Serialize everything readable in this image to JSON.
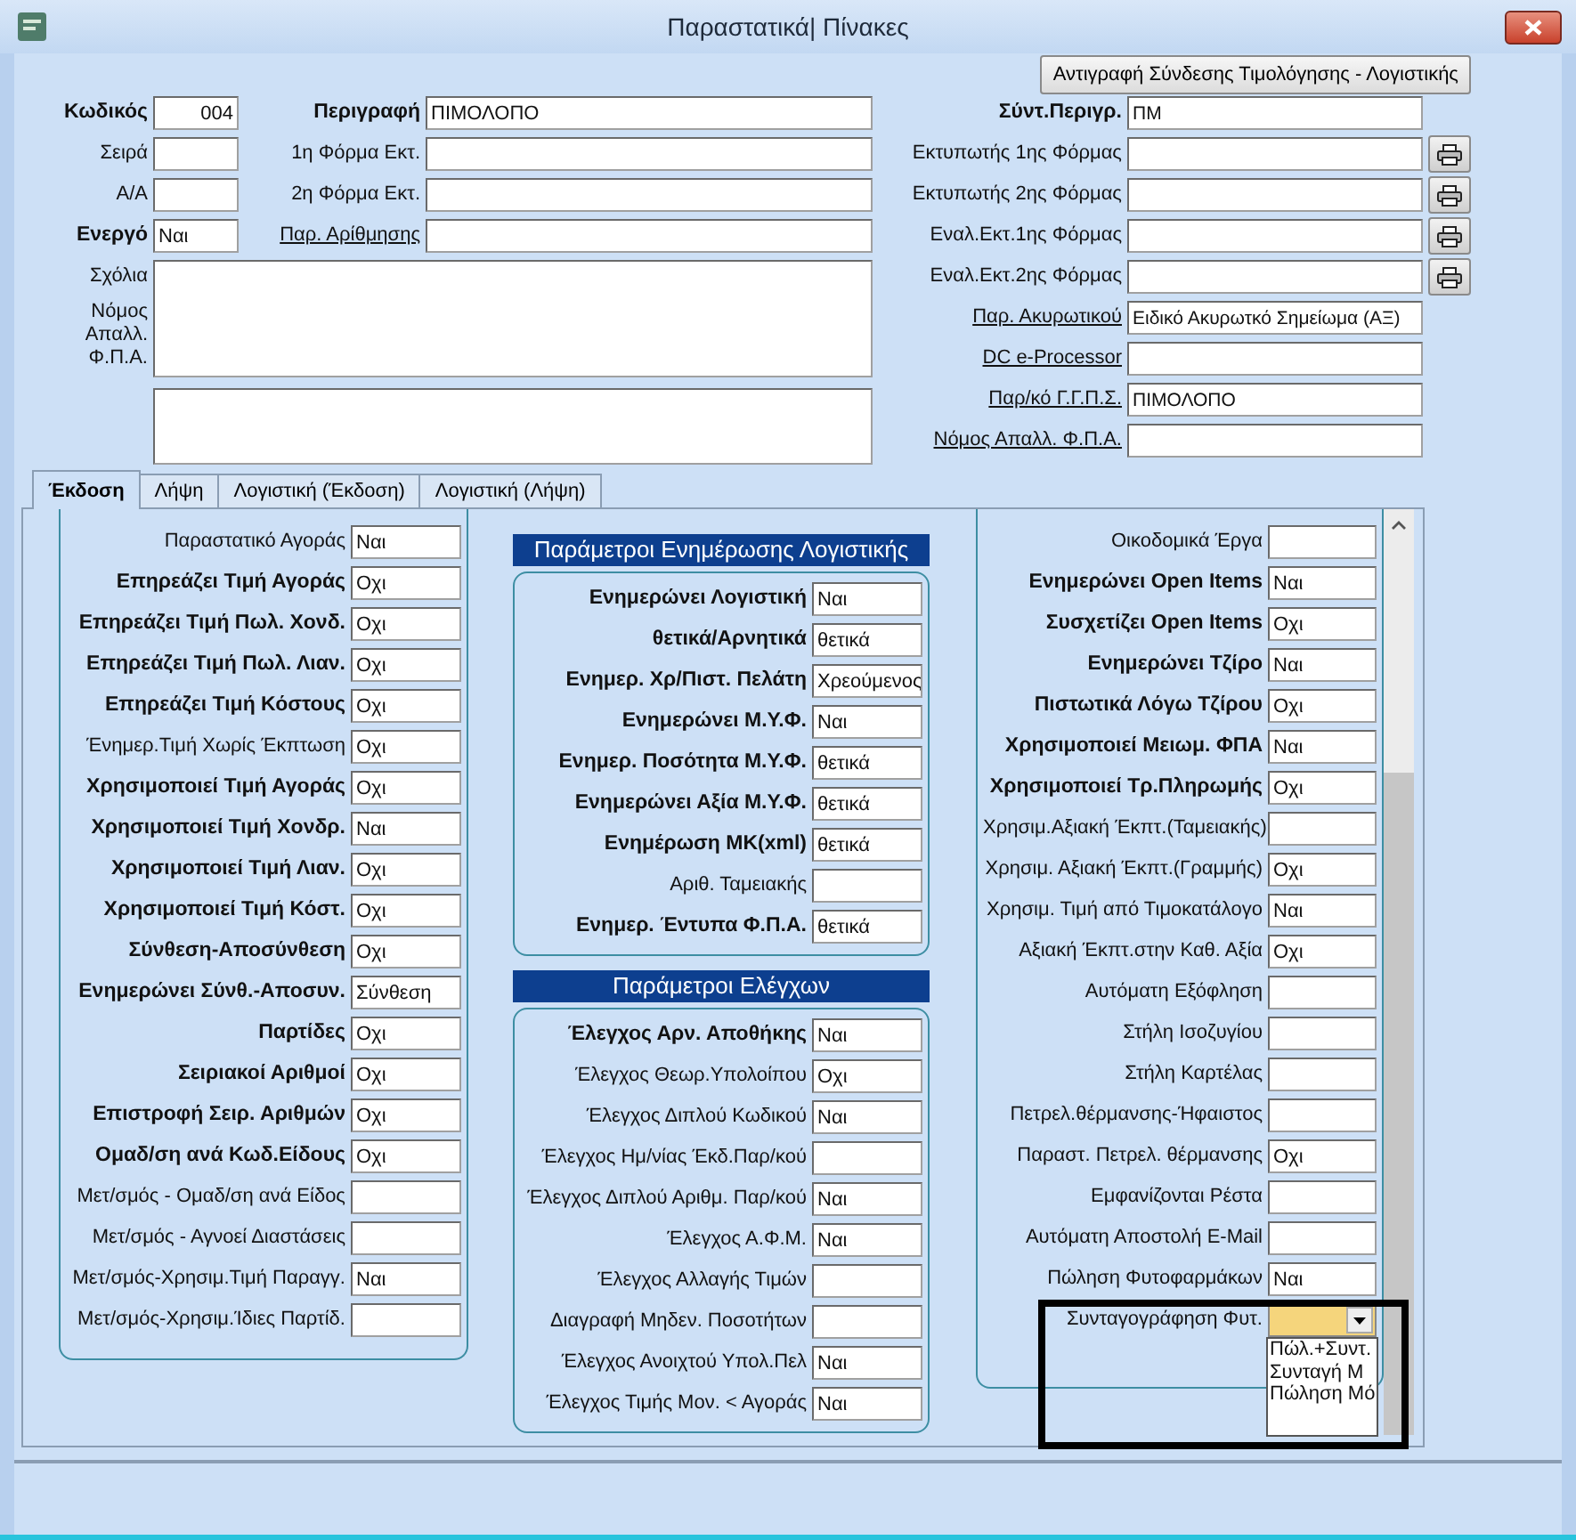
{
  "window": {
    "title": "Παραστατικά| Πίνακες"
  },
  "copy_button": "Αντιγραφή Σύνδεσης Τιμολόγησης - Λογιστικής",
  "header_rows": [
    {
      "left": {
        "label": "Κωδικός",
        "kind": "bold",
        "value": "004"
      },
      "right": {
        "label": "Περιγραφή",
        "kind": "bold",
        "value": "ΠΙΜΟΛΟΠΟ"
      }
    },
    {
      "left": {
        "label": "Σειρά",
        "kind": "normal"
      },
      "right": {
        "label": "1η Φόρμα Εκτ.",
        "kind": "normal"
      }
    },
    {
      "left": {
        "label": "Α/Α",
        "kind": "normal"
      },
      "right": {
        "label": "2η Φόρμα Εκτ.",
        "kind": "normal"
      }
    },
    {
      "left": {
        "label": "Ενεργό",
        "kind": "bold",
        "value": "Ναι"
      },
      "right": {
        "label": "Παρ. Αρίθμησης",
        "kind": "link"
      }
    }
  ],
  "notes": {
    "label": "Σχόλια"
  },
  "vat_exemption": {
    "label": "Νόμος Απαλλ. Φ.Π.Α."
  },
  "right_fields": [
    {
      "label": "Σύντ.Περιγρ.",
      "kind": "bold",
      "value": "ΠΜ",
      "print_button": false
    },
    {
      "label": "Εκτυπωτής 1ης Φόρμας",
      "kind": "normal",
      "print_button": true
    },
    {
      "label": "Εκτυπωτής 2ης Φόρμας",
      "kind": "normal",
      "print_button": true
    },
    {
      "label": "Εναλ.Εκτ.1ης Φόρμας",
      "kind": "normal",
      "print_button": true
    },
    {
      "label": "Εναλ.Εκτ.2ης Φόρμας",
      "kind": "normal",
      "print_button": true
    },
    {
      "label": "Παρ. Ακυρωτικού",
      "kind": "link",
      "value": "Ειδικό Ακυρωτκό Σημείωμα (ΑΞ)",
      "print_button": false
    },
    {
      "label": "DC e-Processor",
      "kind": "link",
      "print_button": false
    },
    {
      "label": "Παρ/κό Γ.Γ.Π.Σ.",
      "kind": "link",
      "value": "ΠΙΜΟΛΟΠΟ",
      "print_button": false
    },
    {
      "label": "Νόμος Απαλλ. Φ.Π.Α.",
      "kind": "link",
      "print_button": false
    }
  ],
  "tabs": [
    {
      "label": "Έκδοση",
      "selected": true
    },
    {
      "label": "Λήψη",
      "selected": false
    },
    {
      "label": "Λογιστική (Έκδοση)",
      "selected": false
    },
    {
      "label": "Λογιστική (Λήψη)",
      "selected": false
    }
  ],
  "left_group": {
    "fields": [
      {
        "label": "Παραστατικό Αγοράς",
        "kind": "normal",
        "value": "Ναι"
      },
      {
        "label": "Επηρεάζει Τιμή Αγοράς",
        "kind": "bold",
        "value": "Οχι"
      },
      {
        "label": "Επηρεάζει Τιμή Πωλ. Χονδ.",
        "kind": "bold",
        "value": "Οχι"
      },
      {
        "label": "Επηρεάζει Τιμή Πωλ. Λιαν.",
        "kind": "bold",
        "value": "Οχι"
      },
      {
        "label": "Επηρεάζει Τιμή Κόστους",
        "kind": "bold",
        "value": "Οχι"
      },
      {
        "label": "Ένημερ.Τιμή Χωρίς Έκπτωση",
        "kind": "normal",
        "value": "Οχι"
      },
      {
        "label": "Χρησιμοποιεί Τιμή Αγοράς",
        "kind": "bold",
        "value": "Οχι"
      },
      {
        "label": "Χρησιμοποιεί Τιμή Χονδρ.",
        "kind": "bold",
        "value": "Ναι"
      },
      {
        "label": "Χρησιμοποιεί Τιμή Λιαν.",
        "kind": "bold",
        "value": "Οχι"
      },
      {
        "label": "Χρησιμοποιεί Τιμή Κόστ.",
        "kind": "bold",
        "value": "Οχι"
      },
      {
        "label": "Σύνθεση-Αποσύνθεση",
        "kind": "bold",
        "value": "Οχι"
      },
      {
        "label": "Ενημερώνει Σύνθ.-Αποσυν.",
        "kind": "bold",
        "value": "Σύνθεση"
      },
      {
        "label": "Παρτίδες",
        "kind": "bold",
        "value": "Οχι"
      },
      {
        "label": "Σειριακοί Αριθμοί",
        "kind": "bold",
        "value": "Οχι"
      },
      {
        "label": "Επιστροφή Σειρ. Αριθμών",
        "kind": "bold",
        "value": "Οχι"
      },
      {
        "label": "Ομαδ/ση ανά Κωδ.Είδους",
        "kind": "bold",
        "value": "Οχι"
      },
      {
        "label": "Μετ/σμός - Ομαδ/ση ανά Είδος",
        "kind": "normal"
      },
      {
        "label": "Μετ/σμός - Αγνοεί Διαστάσεις",
        "kind": "normal"
      },
      {
        "label": "Μετ/σμός-Χρησιμ.Τιμή Παραγγ.",
        "kind": "normal",
        "value": "Ναι"
      },
      {
        "label": "Μετ/σμός-Χρησιμ.Ίδιες Παρτίδ.",
        "kind": "normal"
      }
    ]
  },
  "middle_groups": [
    {
      "title": "Παράμετροι Ενημέρωσης Λογιστικής",
      "fields": [
        {
          "label": "Ενημερώνει Λογιστική",
          "kind": "bold",
          "value": "Ναι"
        },
        {
          "label": "θετικά/Αρνητικά",
          "kind": "bold",
          "value": "θετικά"
        },
        {
          "label": "Ενημερ. Χρ/Πιστ. Πελάτη",
          "kind": "bold",
          "value": "Χρεούμενος"
        },
        {
          "label": "Ενημερώνει Μ.Υ.Φ.",
          "kind": "bold",
          "value": "Ναι"
        },
        {
          "label": "Ενημερ. Ποσότητα Μ.Υ.Φ.",
          "kind": "bold",
          "value": "θετικά"
        },
        {
          "label": "Ενημερώνει  Αξία Μ.Υ.Φ.",
          "kind": "bold",
          "value": "θετικά"
        },
        {
          "label": "Ενημέρωση ΜΚ(xml)",
          "kind": "bold",
          "value": "θετικά"
        },
        {
          "label": "Αριθ. Ταμειακής",
          "kind": "normal"
        },
        {
          "label": "Ενημερ. Έντυπα Φ.Π.Α.",
          "kind": "bold",
          "value": "θετικά"
        }
      ]
    },
    {
      "title": "Παράμετροι Ελέγχων",
      "fields": [
        {
          "label": "Έλεγχος Αρν. Αποθήκης",
          "kind": "bold",
          "value": "Ναι"
        },
        {
          "label": "Έλεγχος Θεωρ.Υπολοίπου",
          "kind": "normal",
          "value": "Οχι"
        },
        {
          "label": "Έλεγχος Διπλού Κωδικού",
          "kind": "normal",
          "value": "Ναι"
        },
        {
          "label": "Έλεγχος Ημ/νίας  Έκδ.Παρ/κού",
          "kind": "normal"
        },
        {
          "label": "Έλεγχος Διπλού Αριθμ. Παρ/κού",
          "kind": "normal",
          "value": "Ναι"
        },
        {
          "label": "Έλεγχος Α.Φ.Μ.",
          "kind": "normal",
          "value": "Ναι"
        },
        {
          "label": "Έλεγχος Αλλαγής Τιμών",
          "kind": "normal"
        },
        {
          "label": "Διαγραφή Μηδεν. Ποσοτήτων",
          "kind": "normal"
        },
        {
          "label": "Έλεγχος Ανοιχτού Υπολ.Πελ",
          "kind": "normal",
          "value": "Ναι"
        },
        {
          "label": "Έλεγχος Τιμής Μον. < Αγοράς",
          "kind": "normal",
          "value": "Ναι"
        }
      ]
    }
  ],
  "right_group": {
    "fields": [
      {
        "label": "Οικοδομικά Έργα",
        "kind": "normal"
      },
      {
        "label": "Ενημερώνει Open Items",
        "kind": "bold",
        "value": "Ναι"
      },
      {
        "label": "Συσχετίζει Open Items",
        "kind": "bold",
        "value": "Οχι"
      },
      {
        "label": "Ενημερώνει Τζίρο",
        "kind": "bold",
        "value": "Ναι"
      },
      {
        "label": "Πιστωτικά Λόγω Τζίρου",
        "kind": "bold",
        "value": "Οχι"
      },
      {
        "label": "Χρησιμοποιεί Μειωμ. ΦΠΑ",
        "kind": "bold",
        "value": "Ναι"
      },
      {
        "label": "Χρησιμοποιεί Τρ.Πληρωμής",
        "kind": "bold",
        "value": "Οχι"
      },
      {
        "label": "Χρησιμ.Αξιακή Έκπτ.(Ταμειακής)",
        "kind": "normal"
      },
      {
        "label": "Χρησιμ. Αξιακή Έκπτ.(Γραμμής)",
        "kind": "normal",
        "value": "Οχι"
      },
      {
        "label": "Χρησιμ. Τιμή από Τιμοκατάλογο",
        "kind": "normal",
        "value": "Ναι"
      },
      {
        "label": "Αξιακή  Έκπτ.στην Καθ. Αξία",
        "kind": "normal",
        "value": "Οχι"
      },
      {
        "label": "Αυτόματη Εξόφληση",
        "kind": "normal"
      },
      {
        "label": "Στήλη Ισοζυγίου",
        "kind": "normal"
      },
      {
        "label": "Στήλη Καρτέλας",
        "kind": "normal"
      },
      {
        "label": "Πετρελ.θέρμανσης-Ήφαιστος",
        "kind": "normal"
      },
      {
        "label": "Παραστ. Πετρελ. θέρμανσης",
        "kind": "normal",
        "value": "Οχι"
      },
      {
        "label": "Εμφανίζονται Ρέστα",
        "kind": "normal"
      },
      {
        "label": "Αυτόματη Αποστολή E-Mail",
        "kind": "normal"
      },
      {
        "label": "Πώληση Φυτοφαρμάκων",
        "kind": "normal",
        "value": "Ναι"
      }
    ],
    "combo": {
      "label": "Συνταγογράφηση Φυτ.",
      "focused": true,
      "expanded": true,
      "options": [
        "Πώλ.+Συντ.",
        "Συνταγή Μ",
        "Πώληση Μό"
      ]
    }
  }
}
